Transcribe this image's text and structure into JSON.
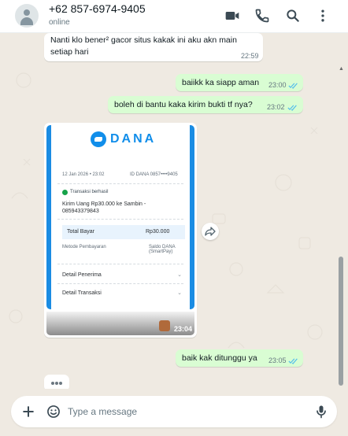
{
  "header": {
    "contact_name": "+62 857-6974-9405",
    "status": "online",
    "icons": [
      "avatar",
      "video-call-icon",
      "voice-call-icon",
      "search-icon",
      "more-vert-icon"
    ]
  },
  "messages": [
    {
      "direction": "in",
      "text_line1": "Nanti klo bener² gacor situs kakak ini aku akn main",
      "text_line2": "setiap hari",
      "time": "22:59"
    },
    {
      "direction": "out",
      "text": "baiikk ka siapp aman",
      "time": "23:00",
      "status": "read"
    },
    {
      "direction": "out",
      "text": "boleh di bantu kaka kirim bukti tf nya?",
      "time": "23:02",
      "status": "read"
    },
    {
      "direction": "out",
      "text": "baik kak ditunggu ya",
      "time": "23:05",
      "status": "read"
    }
  ],
  "image_message": {
    "time": "23:04",
    "receipt": {
      "brand": "DANA",
      "date_line": "12 Jan 2026 • 23:02",
      "id_line": "ID DANA 0857••••9405",
      "status": "Transaksi berhasil",
      "description_line1": "Kirim Uang Rp30.000 ke Sambin -",
      "description_line2": "085943379843",
      "total_label": "Total Bayar",
      "total_value": "Rp30.000",
      "method_label": "Metode Pembayaran",
      "method_value_line1": "Saldo DANA",
      "method_value_line2": "(SmartPay)",
      "recipient_label": "Detail Penerima",
      "transaction_label": "Detail Transaksi"
    }
  },
  "composer": {
    "placeholder": "Type a message"
  },
  "colors": {
    "outgoing_bubble": "#d9fdd3",
    "incoming_bubble": "#ffffff",
    "chat_background": "#efeae2",
    "read_ticks": "#53bdeb",
    "dana_blue": "#118eea"
  }
}
